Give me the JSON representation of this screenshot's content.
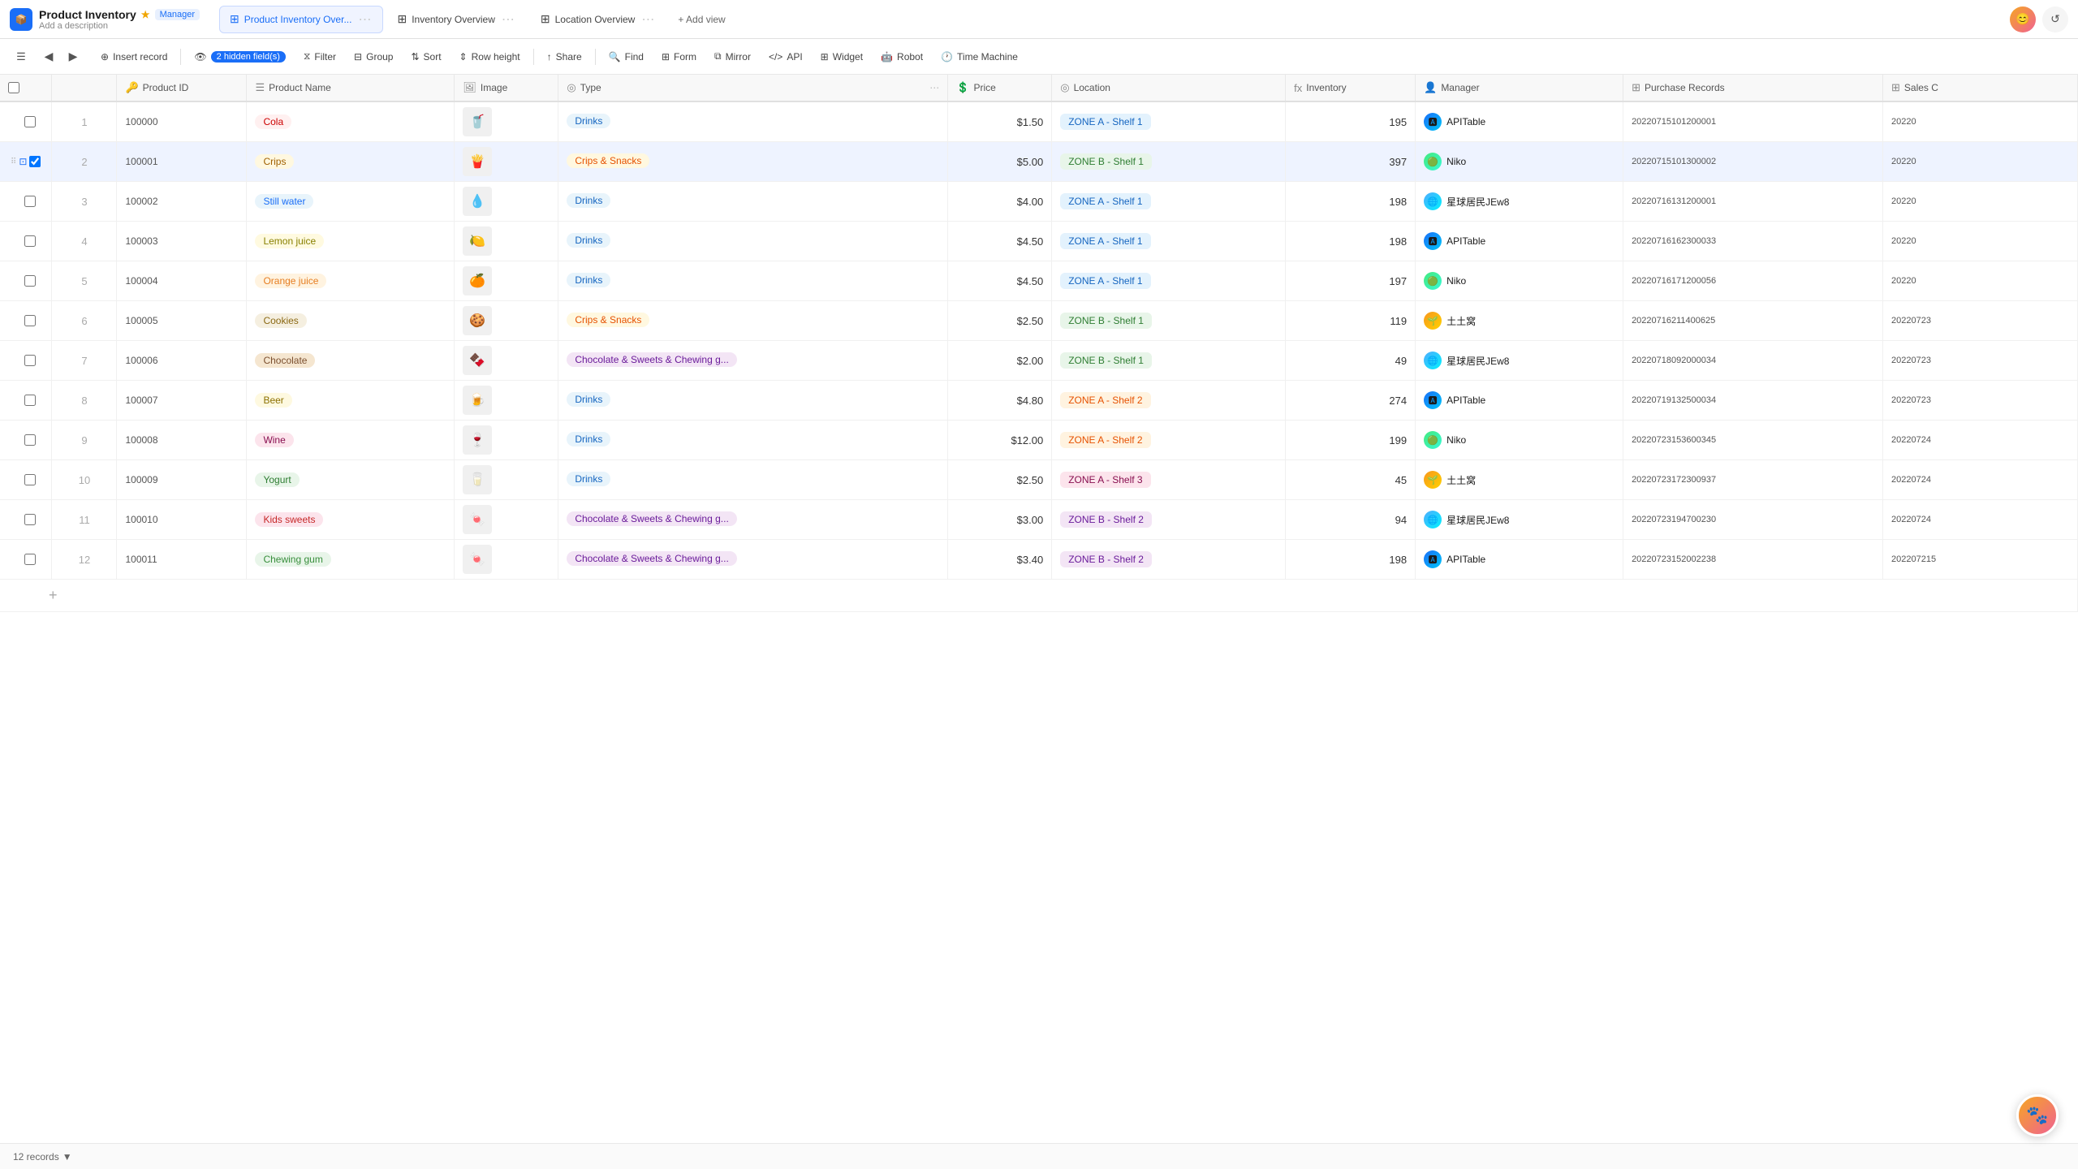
{
  "app": {
    "icon": "📦",
    "title": "Product Inventory",
    "manager_badge": "Manager",
    "subtitle": "Add a description"
  },
  "tabs": [
    {
      "id": "product-inventory",
      "label": "Product Inventory Over...",
      "icon": "⊞",
      "active": true
    },
    {
      "id": "inventory-overview",
      "label": "Inventory Overview",
      "icon": "⊞",
      "active": false
    },
    {
      "id": "location-overview",
      "label": "Location Overview",
      "icon": "⊞",
      "active": false
    }
  ],
  "add_view_label": "+ Add view",
  "toolbar": {
    "hidden_fields": "2 hidden field(s)",
    "filter": "Filter",
    "group": "Group",
    "sort": "Sort",
    "row_height": "Row height",
    "share": "Share",
    "find": "Find",
    "form": "Form",
    "mirror": "Mirror",
    "api": "API",
    "widget": "Widget",
    "robot": "Robot",
    "time_machine": "Time Machine",
    "insert_record": "Insert record"
  },
  "columns": [
    {
      "id": "product-id",
      "label": "Product ID",
      "icon": "🔑"
    },
    {
      "id": "product-name",
      "label": "Product Name",
      "icon": "☰"
    },
    {
      "id": "image",
      "label": "Image",
      "icon": "🖼"
    },
    {
      "id": "type",
      "label": "Type",
      "icon": "◎"
    },
    {
      "id": "price",
      "label": "Price",
      "icon": "💲"
    },
    {
      "id": "location",
      "label": "Location",
      "icon": "◎"
    },
    {
      "id": "inventory",
      "label": "Inventory",
      "icon": "fx"
    },
    {
      "id": "manager",
      "label": "Manager",
      "icon": "👤"
    },
    {
      "id": "purchase-records",
      "label": "Purchase Records",
      "icon": "⊞"
    },
    {
      "id": "sales",
      "label": "Sales C",
      "icon": "⊞"
    }
  ],
  "records": [
    {
      "num": 1,
      "id": "100000",
      "name": "Cola",
      "name_class": "badge-cola",
      "img": "🥤",
      "type": "Drinks",
      "type_class": "type-drinks",
      "price": "$1.50",
      "location": "ZONE A - Shelf 1",
      "loc_class": "loc-za1",
      "inventory": 195,
      "manager": "APITable",
      "mgr_class": "mgr-api",
      "mgr_icon": "🅰",
      "purchase": "20220715101200001",
      "sales": "20220"
    },
    {
      "num": 2,
      "id": "100001",
      "name": "Crips",
      "name_class": "badge-crips",
      "img": "🍟",
      "type": "Crips & Snacks",
      "type_class": "type-snacks",
      "price": "$5.00",
      "location": "ZONE B - Shelf 1",
      "loc_class": "loc-zb1",
      "inventory": 397,
      "manager": "Niko",
      "mgr_class": "mgr-niko",
      "mgr_icon": "🟢",
      "purchase": "20220715101300002",
      "sales": "20220",
      "selected": true
    },
    {
      "num": 3,
      "id": "100002",
      "name": "Still water",
      "name_class": "badge-water",
      "img": "💧",
      "type": "Drinks",
      "type_class": "type-drinks",
      "price": "$4.00",
      "location": "ZONE A - Shelf 1",
      "loc_class": "loc-za1",
      "inventory": 198,
      "manager": "星球居民JEw8",
      "mgr_class": "mgr-planet",
      "mgr_icon": "🌐",
      "purchase": "20220716131200001",
      "sales": "20220"
    },
    {
      "num": 4,
      "id": "100003",
      "name": "Lemon juice",
      "name_class": "badge-lemon",
      "img": "🍋",
      "type": "Drinks",
      "type_class": "type-drinks",
      "price": "$4.50",
      "location": "ZONE A - Shelf 1",
      "loc_class": "loc-za1",
      "inventory": 198,
      "manager": "APITable",
      "mgr_class": "mgr-api",
      "mgr_icon": "🅰",
      "purchase": "20220716162300033",
      "sales": "20220"
    },
    {
      "num": 5,
      "id": "100004",
      "name": "Orange juice",
      "name_class": "badge-orange",
      "img": "🍊",
      "type": "Drinks",
      "type_class": "type-drinks",
      "price": "$4.50",
      "location": "ZONE A - Shelf 1",
      "loc_class": "loc-za1",
      "inventory": 197,
      "manager": "Niko",
      "mgr_class": "mgr-niko",
      "mgr_icon": "🟢",
      "purchase": "20220716171200056",
      "sales": "20220"
    },
    {
      "num": 6,
      "id": "100005",
      "name": "Cookies",
      "name_class": "badge-cookies",
      "img": "🍪",
      "type": "Crips & Snacks",
      "type_class": "type-snacks",
      "price": "$2.50",
      "location": "ZONE B - Shelf 1",
      "loc_class": "loc-zb1",
      "inventory": 119,
      "manager": "土土窝",
      "mgr_class": "mgr-earth",
      "mgr_icon": "🌱",
      "purchase": "20220716211400625",
      "sales": "20220723"
    },
    {
      "num": 7,
      "id": "100006",
      "name": "Chocolate",
      "name_class": "badge-chocolate",
      "img": "🍫",
      "type": "Chocolate & Sweets & Chewing g...",
      "type_class": "type-choc",
      "price": "$2.00",
      "location": "ZONE B - Shelf 1",
      "loc_class": "loc-zb1",
      "inventory": 49,
      "manager": "星球居民JEw8",
      "mgr_class": "mgr-planet",
      "mgr_icon": "🌐",
      "purchase": "20220718092000034",
      "sales": "20220723"
    },
    {
      "num": 8,
      "id": "100007",
      "name": "Beer",
      "name_class": "badge-beer",
      "img": "🍺",
      "type": "Drinks",
      "type_class": "type-drinks",
      "price": "$4.80",
      "location": "ZONE A - Shelf 2",
      "loc_class": "loc-za2",
      "inventory": 274,
      "manager": "APITable",
      "mgr_class": "mgr-api",
      "mgr_icon": "🅰",
      "purchase": "20220719132500034",
      "sales": "20220723"
    },
    {
      "num": 9,
      "id": "100008",
      "name": "Wine",
      "name_class": "badge-wine",
      "img": "🍷",
      "type": "Drinks",
      "type_class": "type-drinks",
      "price": "$12.00",
      "location": "ZONE A - Shelf 2",
      "loc_class": "loc-za2",
      "inventory": 199,
      "manager": "Niko",
      "mgr_class": "mgr-niko",
      "mgr_icon": "🟢",
      "purchase": "20220723153600345",
      "sales": "20220724"
    },
    {
      "num": 10,
      "id": "100009",
      "name": "Yogurt",
      "name_class": "badge-yogurt",
      "img": "🥛",
      "type": "Drinks",
      "type_class": "type-drinks",
      "price": "$2.50",
      "location": "ZONE A - Shelf 3",
      "loc_class": "loc-za3",
      "inventory": 45,
      "manager": "土土窝",
      "mgr_class": "mgr-earth",
      "mgr_icon": "🌱",
      "purchase": "20220723172300937",
      "sales": "20220724"
    },
    {
      "num": 11,
      "id": "100010",
      "name": "Kids sweets",
      "name_class": "badge-kids",
      "img": "🍬",
      "type": "Chocolate & Sweets & Chewing g...",
      "type_class": "type-choc",
      "price": "$3.00",
      "location": "ZONE B - Shelf 2",
      "loc_class": "loc-zb2",
      "inventory": 94,
      "manager": "星球居民JEw8",
      "mgr_class": "mgr-planet",
      "mgr_icon": "🌐",
      "purchase": "20220723194700230",
      "sales": "20220724"
    },
    {
      "num": 12,
      "id": "100011",
      "name": "Chewing gum",
      "name_class": "badge-gum",
      "img": "🍬",
      "type": "Chocolate & Sweets & Chewing g...",
      "type_class": "type-choc",
      "price": "$3.40",
      "location": "ZONE B - Shelf 2",
      "loc_class": "loc-zb2",
      "inventory": 198,
      "manager": "APITable",
      "mgr_class": "mgr-api",
      "mgr_icon": "🅰",
      "purchase": "20220723152002238",
      "sales": "202207215"
    }
  ],
  "footer": {
    "records_count": "12 records",
    "arrow": "▼"
  }
}
